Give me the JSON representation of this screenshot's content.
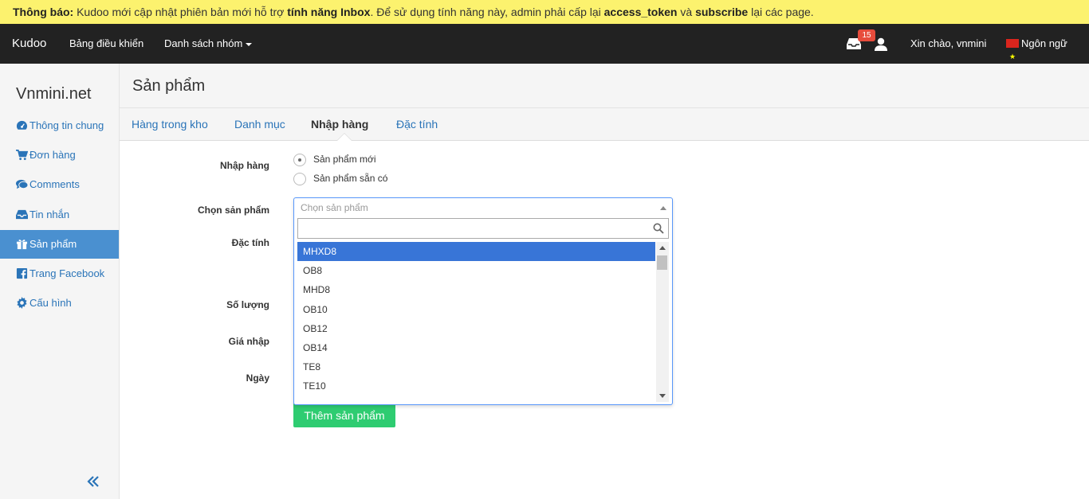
{
  "notice": {
    "prefix": "Thông báo:",
    "text1": " Kudoo mới cập nhật phiên bản mới hỗ trợ ",
    "bold1": "tính năng Inbox",
    "text2": ". Để sử dụng tính năng này, admin phải cấp lại ",
    "bold2": "access_token",
    "text3": " và ",
    "bold3": "subscribe",
    "text4": " lại các page."
  },
  "navbar": {
    "brand": "Kudoo",
    "dashboard": "Bảng điều khiển",
    "groups": "Danh sách nhóm",
    "inbox_count": "15",
    "greeting": "Xin chào, vnmini",
    "language": "Ngôn ngữ"
  },
  "sidebar": {
    "site_title": "Vnmini.net",
    "items": [
      {
        "label": "Thông tin chung",
        "icon": "dashboard-icon"
      },
      {
        "label": "Đơn hàng",
        "icon": "cart-icon"
      },
      {
        "label": "Comments",
        "icon": "comments-icon"
      },
      {
        "label": "Tin nhắn",
        "icon": "inbox-icon"
      },
      {
        "label": "Sản phẩm",
        "icon": "gift-icon"
      },
      {
        "label": "Trang Facebook",
        "icon": "facebook-icon"
      },
      {
        "label": "Cấu hình",
        "icon": "gear-icon"
      }
    ],
    "active_index": 4
  },
  "page": {
    "title": "Sản phẩm",
    "tabs": [
      "Hàng trong kho",
      "Danh mục",
      "Nhập hàng",
      "Đặc tính"
    ],
    "active_tab": 2
  },
  "form": {
    "labels": {
      "import": "Nhập hàng",
      "choose_product": "Chọn sản phẩm",
      "attribute": "Đặc tính",
      "quantity": "Số lượng",
      "import_price": "Giá nhập",
      "date": "Ngày"
    },
    "radio_options": [
      "Sản phẩm mới",
      "Sản phẩm sẵn có"
    ],
    "radio_selected": 0,
    "select": {
      "placeholder": "Chọn sản phẩm",
      "search_value": "",
      "options": [
        "MHXD8",
        "OB8",
        "MHD8",
        "OB10",
        "OB12",
        "OB14",
        "TE8",
        "TE10"
      ],
      "highlighted": 0
    },
    "submit_label": "Thêm sản phẩm"
  },
  "colors": {
    "notice_bg": "#fcf26e",
    "navbar_bg": "#222222",
    "link": "#2a74b8",
    "active_sidebar": "#4a90d0",
    "highlight_option": "#3875d7",
    "submit": "#2ecc71",
    "badge": "#e74c3c"
  }
}
